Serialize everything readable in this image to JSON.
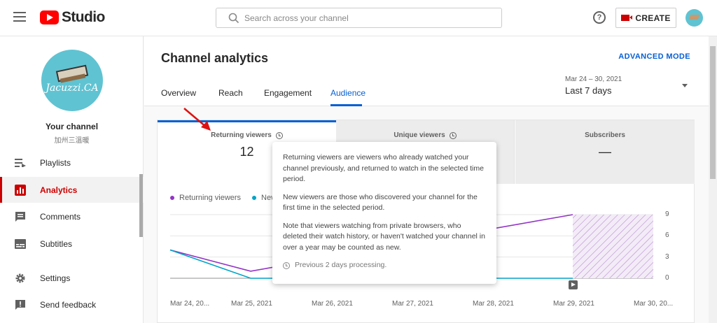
{
  "topbar": {
    "logo_text": "Studio",
    "search_placeholder": "Search across your channel",
    "create_label": "CREATE"
  },
  "sidebar": {
    "channel_name": "Your channel",
    "channel_handle": "加州三溫暖",
    "avatar_text": "Jacuzzi.CA",
    "items": [
      {
        "label": "Playlists",
        "icon": "playlist-icon"
      },
      {
        "label": "Analytics",
        "icon": "analytics-icon",
        "active": true
      },
      {
        "label": "Comments",
        "icon": "comments-icon"
      },
      {
        "label": "Subtitles",
        "icon": "subtitles-icon"
      },
      {
        "label": "Settings",
        "icon": "gear-icon"
      },
      {
        "label": "Send feedback",
        "icon": "feedback-icon"
      }
    ]
  },
  "main": {
    "title": "Channel analytics",
    "advanced_mode": "ADVANCED MODE",
    "tabs": [
      "Overview",
      "Reach",
      "Engagement",
      "Audience"
    ],
    "active_tab": "Audience",
    "date_range": "Mar 24 – 30, 2021",
    "date_period": "Last 7 days",
    "metrics": [
      {
        "label": "Returning viewers",
        "value": "12"
      },
      {
        "label": "Unique viewers",
        "value": ""
      },
      {
        "label": "Subscribers",
        "value": "—"
      }
    ],
    "legend": [
      {
        "label": "Returning viewers",
        "color": "#9334c6"
      },
      {
        "label": "New",
        "color": "#00a4c7"
      }
    ]
  },
  "chart_data": {
    "type": "line",
    "x": [
      "Mar 24, 20...",
      "Mar 25, 2021",
      "Mar 26, 2021",
      "Mar 27, 2021",
      "Mar 28, 2021",
      "Mar 29, 2021",
      "Mar 30, 20..."
    ],
    "y_ticks": [
      0,
      3,
      6,
      9
    ],
    "ylim": [
      0,
      9
    ],
    "series": [
      {
        "name": "Returning viewers",
        "color": "#9334c6",
        "values": [
          4,
          1,
          null,
          null,
          null,
          9,
          null
        ]
      },
      {
        "name": "New viewers",
        "color": "#00a4c7",
        "values": [
          4,
          0,
          null,
          null,
          null,
          0,
          null
        ]
      }
    ],
    "processing_region": "Mar 29 – Mar 30"
  },
  "tooltip": {
    "p1": "Returning viewers are viewers who already watched your channel previously, and returned to watch in the selected time period.",
    "p2": "New viewers are those who discovered your channel for the first time in the selected period.",
    "p3": "Note that viewers watching from private browsers, who deleted their watch history, or haven't watched your channel in over a year may be counted as new.",
    "note": "Previous 2 days processing."
  }
}
